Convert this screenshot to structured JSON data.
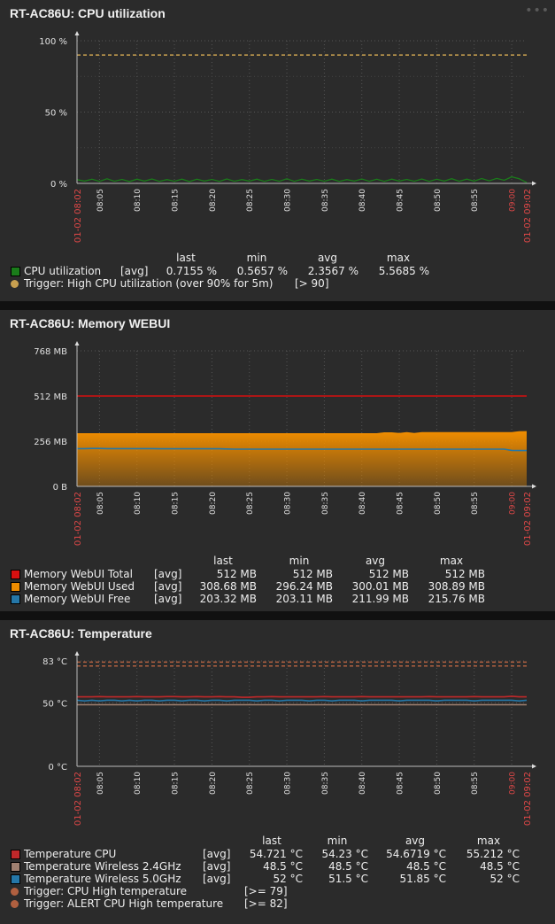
{
  "panels": [
    {
      "title": "RT-AC86U: CPU utilization",
      "menu_icon": "more-dots-icon",
      "chart_data": {
        "type": "line",
        "x_start": "01-02 08:02",
        "x_end": "01-02 09:02",
        "x_ticks": [
          "08:05",
          "08:10",
          "08:15",
          "08:20",
          "08:25",
          "08:30",
          "08:35",
          "08:40",
          "08:45",
          "08:50",
          "08:55",
          "09:00"
        ],
        "y_ticks": [
          "100 %",
          "50 %",
          "0 %"
        ],
        "ylim": [
          0,
          100
        ],
        "grid": true,
        "series": [
          {
            "name": "CPU utilization",
            "color": "#1a7c1a",
            "func": "[avg]",
            "last": "0.7155 %",
            "min": "0.5657 %",
            "avg": "2.3567 %",
            "max": "5.5685 %",
            "values": [
              2.6,
              1.6,
              2.9,
              1.4,
              3.2,
              1.5,
              2.8,
              1.3,
              3.0,
              1.6,
              3.1,
              1.4,
              2.7,
              1.5,
              3.0,
              1.3,
              2.9,
              1.6,
              2.8,
              1.4,
              3.1,
              1.5,
              2.7,
              1.6,
              3.0,
              1.4,
              2.8,
              1.5,
              3.2,
              1.4,
              2.9,
              1.6,
              2.8,
              1.5,
              3.0,
              1.4,
              2.7,
              1.6,
              3.1,
              1.5,
              2.9,
              1.4,
              3.0,
              1.6,
              2.8,
              1.5,
              3.1,
              1.4,
              2.9,
              1.6,
              3.3,
              1.5,
              3.0,
              1.6,
              3.4,
              1.8,
              3.5,
              2.2,
              4.6,
              3.2,
              0.7
            ]
          }
        ],
        "triggers": [
          {
            "label": "Trigger: High CPU utilization (over 90% for 5m)",
            "condition": "[> 90]",
            "value": 90,
            "color": "#c8a050"
          }
        ],
        "legend_headers": [
          "last",
          "min",
          "avg",
          "max"
        ]
      }
    },
    {
      "title": "RT-AC86U: Memory WEBUI",
      "chart_data": {
        "type": "area",
        "x_start": "01-02 08:02",
        "x_end": "01-02 09:02",
        "x_ticks": [
          "08:05",
          "08:10",
          "08:15",
          "08:20",
          "08:25",
          "08:30",
          "08:35",
          "08:40",
          "08:45",
          "08:50",
          "08:55",
          "09:00"
        ],
        "y_ticks": [
          "768 MB",
          "512 MB",
          "256 MB",
          "0 B"
        ],
        "ylim": [
          0,
          768
        ],
        "grid": true,
        "series": [
          {
            "name": "Memory WebUI Total",
            "color": "#d81010",
            "func": "[avg]",
            "last": "512 MB",
            "min": "512 MB",
            "avg": "512 MB",
            "max": "512 MB",
            "values": [
              512,
              512
            ]
          },
          {
            "name": "Memory WebUI Used",
            "color": "#ee8c00",
            "func": "[avg]",
            "last": "308.68 MB",
            "min": "296.24 MB",
            "avg": "300.01 MB",
            "max": "308.89 MB",
            "values": [
              297,
              297,
              297,
              297,
              297,
              297,
              297,
              297,
              297,
              297,
              297,
              297,
              297,
              297,
              297,
              297,
              297,
              297,
              297,
              297,
              297,
              297,
              297,
              297,
              297,
              297,
              297,
              297,
              297,
              297,
              297,
              297,
              297,
              297,
              297,
              297,
              297,
              297,
              297,
              297,
              297,
              302,
              302,
              298,
              303,
              298,
              303,
              303,
              303,
              303,
              303,
              303,
              303,
              303,
              303,
              303,
              303,
              303,
              303,
              308,
              309
            ]
          },
          {
            "name": "Memory WebUI Free",
            "color": "#2577a8",
            "func": "[avg]",
            "last": "203.32 MB",
            "min": "203.11 MB",
            "avg": "211.99 MB",
            "max": "215.76 MB",
            "values": [
              214,
              214,
              215,
              215,
              214,
              214,
              214,
              214,
              214,
              214,
              214,
              213,
              213,
              213,
              213,
              213,
              213,
              213,
              213,
              213,
              212,
              211,
              211,
              211,
              211,
              211,
              211,
              211,
              211,
              211,
              211,
              211,
              211,
              211,
              211,
              211,
              211,
              211,
              211,
              211,
              211,
              211,
              211,
              211,
              211,
              211,
              211,
              211,
              211,
              211,
              211,
              211,
              211,
              211,
              211,
              211,
              211,
              211,
              204,
              203,
              203
            ]
          }
        ],
        "legend_headers": [
          "last",
          "min",
          "avg",
          "max"
        ]
      }
    },
    {
      "title": "RT-AC86U: Temperature",
      "chart_data": {
        "type": "line",
        "x_start": "01-02 08:02",
        "x_end": "01-02 09:02",
        "x_ticks": [
          "08:05",
          "08:10",
          "08:15",
          "08:20",
          "08:25",
          "08:30",
          "08:35",
          "08:40",
          "08:45",
          "08:50",
          "08:55",
          "09:00"
        ],
        "y_ticks": [
          "83 °C",
          "50 °C",
          "0 °C"
        ],
        "ylim": [
          0,
          83
        ],
        "grid": true,
        "series": [
          {
            "name": "Temperature CPU",
            "color": "#c0282a",
            "func": "[avg]",
            "last": "54.721 °C",
            "min": "54.23 °C",
            "avg": "54.6719 °C",
            "max": "55.212 °C",
            "values": [
              54.7,
              54.7,
              54.7,
              54.9,
              54.7,
              54.7,
              54.7,
              54.7,
              54.9,
              54.7,
              54.7,
              54.7,
              54.9,
              54.9,
              54.7,
              54.7,
              54.9,
              54.7,
              54.7,
              54.9,
              54.7,
              54.7,
              54.3,
              54.3,
              54.7,
              54.7,
              54.9,
              54.7,
              54.7,
              54.7,
              54.7,
              54.7,
              54.7,
              54.9,
              54.7,
              54.7,
              54.7,
              54.7,
              54.9,
              54.7,
              54.7,
              54.7,
              54.7,
              54.7,
              54.7,
              54.7,
              54.7,
              54.9,
              54.7,
              54.7,
              54.7,
              54.7,
              54.7,
              54.9,
              54.7,
              54.7,
              54.7,
              54.7,
              55.2,
              54.7,
              54.7
            ]
          },
          {
            "name": "Temperature Wireless 2.4GHz",
            "color": "#a08070",
            "func": "[avg]",
            "last": "48.5 °C",
            "min": "48.5 °C",
            "avg": "48.5 °C",
            "max": "48.5 °C",
            "values": [
              48.5,
              48.5
            ]
          },
          {
            "name": "Temperature Wireless 5.0GHz",
            "color": "#2577a8",
            "func": "[avg]",
            "last": "52 °C",
            "min": "51.5 °C",
            "avg": "51.85 °C",
            "max": "52 °C",
            "values": [
              52,
              51.5,
              52,
              51.5,
              52,
              52,
              51.5,
              52,
              51.5,
              52,
              52,
              51.5,
              52,
              52,
              51.5,
              52,
              52,
              51.5,
              52,
              52,
              51.5,
              52,
              52,
              52,
              51.5,
              52,
              52,
              51.5,
              52,
              52,
              52,
              51.5,
              52,
              52,
              51.5,
              52,
              52,
              52,
              51.5,
              52,
              52,
              52,
              52,
              51.5,
              52,
              52,
              52,
              52,
              51.5,
              52,
              52,
              52,
              52,
              51.5,
              52,
              52,
              52,
              52,
              52,
              51.5,
              52
            ]
          }
        ],
        "triggers": [
          {
            "label": "Trigger: CPU High temperature",
            "condition": "[>= 79]",
            "value": 79,
            "color": "#b06040"
          },
          {
            "label": "Trigger: ALERT CPU High temperature",
            "condition": "[>= 82]",
            "value": 82,
            "color": "#b06040"
          }
        ],
        "legend_headers": [
          "last",
          "min",
          "avg",
          "max"
        ]
      }
    }
  ]
}
